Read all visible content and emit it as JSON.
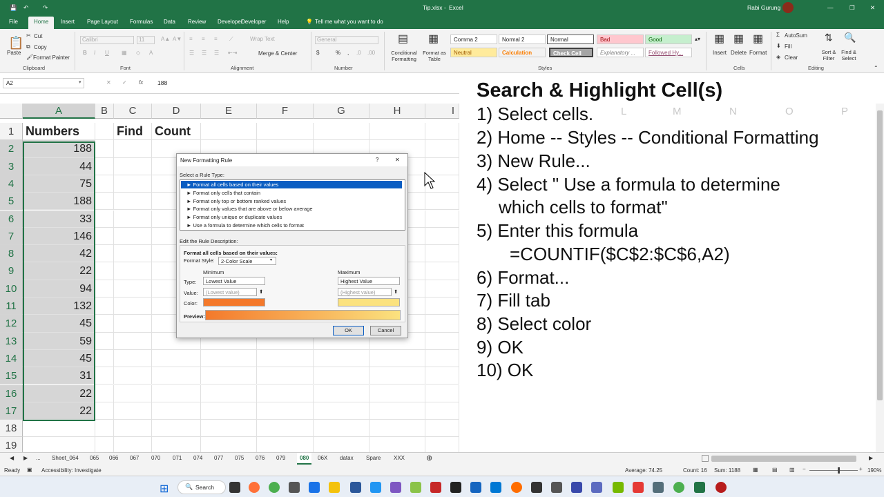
{
  "titlebar": {
    "filename": "Tip.xlsx",
    "sep": "-",
    "app": "Excel",
    "user": "Rabi Gurung"
  },
  "menu": [
    "File",
    "Home",
    "Insert",
    "Page Layout",
    "Formulas",
    "Data",
    "Review",
    "Developer",
    "Help"
  ],
  "tellme": "Tell me what you want to do",
  "ribbon": {
    "clipboard": {
      "paste": "Paste",
      "cut": "Cut",
      "copy": "Copy",
      "painter": "Format Painter",
      "label": "Clipboard"
    },
    "font": {
      "name": "Calibri",
      "size": "11",
      "label": "Font"
    },
    "alignment": {
      "wrap": "Wrap Text",
      "merge": "Merge & Center",
      "label": "Alignment"
    },
    "number": {
      "format": "General",
      "label": "Number"
    },
    "styles": {
      "cond": "Conditional Formatting",
      "table": "Format as Table",
      "label": "Styles",
      "cells": [
        "Comma 2",
        "Normal 2",
        "Normal",
        "Bad",
        "Good",
        "Neutral",
        "Calculation",
        "Check Cell",
        "Explanatory ...",
        "Followed Hy..."
      ]
    },
    "cells": {
      "insert": "Insert",
      "delete": "Delete",
      "format": "Format",
      "label": "Cells"
    },
    "editing": {
      "autosum": "AutoSum",
      "fill": "Fill",
      "clear": "Clear",
      "sort": "Sort & Filter",
      "find": "Find & Select",
      "label": "Editing"
    }
  },
  "formula_bar": {
    "namebox": "A2",
    "fx": "fx",
    "value": "188"
  },
  "columns": [
    "A",
    "B",
    "C",
    "D",
    "E",
    "F",
    "G",
    "H",
    "I"
  ],
  "faint_columns": [
    "L",
    "M",
    "N",
    "O",
    "P"
  ],
  "rows": [
    {
      "n": "1",
      "a": "Numbers",
      "c": "Find",
      "d": "Count"
    },
    {
      "n": "2",
      "a": "188"
    },
    {
      "n": "3",
      "a": "44"
    },
    {
      "n": "4",
      "a": "75"
    },
    {
      "n": "5",
      "a": "188"
    },
    {
      "n": "6",
      "a": "33"
    },
    {
      "n": "7",
      "a": "146"
    },
    {
      "n": "8",
      "a": "42"
    },
    {
      "n": "9",
      "a": "22"
    },
    {
      "n": "10",
      "a": "94"
    },
    {
      "n": "11",
      "a": "132"
    },
    {
      "n": "12",
      "a": "45"
    },
    {
      "n": "13",
      "a": "59"
    },
    {
      "n": "14",
      "a": "45"
    },
    {
      "n": "15",
      "a": "31"
    },
    {
      "n": "16",
      "a": "22"
    },
    {
      "n": "17",
      "a": "22"
    },
    {
      "n": "18",
      "a": ""
    },
    {
      "n": "19",
      "a": ""
    }
  ],
  "dialog": {
    "title": "New Formatting Rule",
    "help": "?",
    "close": "✕",
    "select_label": "Select a Rule Type:",
    "rules": [
      "► Format all cells based on their values",
      "► Format only cells that contain",
      "► Format only top or bottom ranked values",
      "► Format only values that are above or below average",
      "► Format only unique or duplicate values",
      "► Use a formula to determine which cells to format"
    ],
    "edit_label": "Edit the Rule Description:",
    "desc_title": "Format all cells based on their values:",
    "style_label": "Format Style:",
    "style_value": "2-Color Scale",
    "min_label": "Minimum",
    "max_label": "Maximum",
    "type_label": "Type:",
    "value_label": "Value:",
    "color_label": "Color:",
    "min_type": "Lowest Value",
    "max_type": "Highest Value",
    "min_value": "(Lowest value)",
    "max_value": "(Highest value)",
    "preview_label": "Preview:",
    "ok": "OK",
    "cancel": "Cancel",
    "colors": {
      "min": "#f4792b",
      "max": "#fbe27f"
    }
  },
  "instructions": {
    "title": "Search & Highlight Cell(s)",
    "steps": [
      "1) Select cells.",
      "2) Home -- Styles -- Conditional Formatting",
      "3) New Rule...",
      "4) Select \" Use a formula to determine",
      "which cells to format\"",
      "5) Enter this formula",
      "=COUNTIF($C$2:$C$6,A2)",
      "6) Format...",
      "7) Fill tab",
      "8) Select color",
      "9) OK",
      "10) OK"
    ]
  },
  "sheet_tabs": [
    "...",
    "Sheet_064",
    "065",
    "066",
    "067",
    "070",
    "071",
    "074",
    "077",
    "075",
    "076",
    "079",
    "080",
    "06X",
    "datax",
    "Spare",
    "XXX"
  ],
  "active_tab": "080",
  "status": {
    "ready": "Ready",
    "accessibility": "Accessibility: Investigate",
    "average": "Average: 74.25",
    "count": "Count: 16",
    "sum": "Sum: 1188",
    "zoom": "190%"
  },
  "taskbar": {
    "search": "Search"
  },
  "accent": "#217346"
}
